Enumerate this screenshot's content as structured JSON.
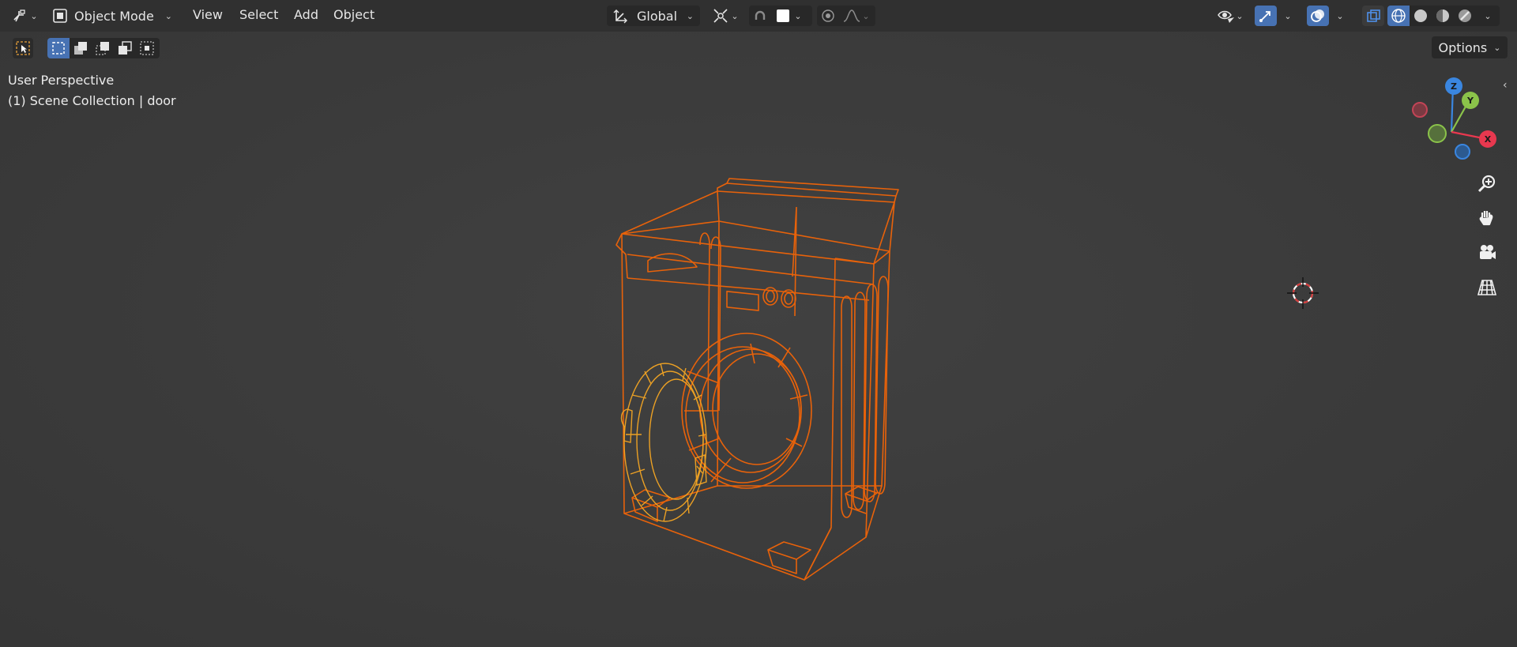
{
  "header": {
    "mode": {
      "label": "Object Mode"
    },
    "menus": [
      "View",
      "Select",
      "Add",
      "Object"
    ],
    "transform_orientation": {
      "label": "Global"
    },
    "options_label": "Options"
  },
  "viewport": {
    "view_name": "User Perspective",
    "collection_info": "(1) Scene Collection | door"
  },
  "gizmo": {
    "z_label": "Z",
    "y_label": "Y",
    "x_label": "X"
  },
  "colors": {
    "header_bg": "#303030",
    "viewport_bg": "#3d3d3d",
    "accent_blue": "#4772b3",
    "selection_orange": "#e8620a",
    "active_orange": "#f5a623",
    "axis_x": "#e8384f",
    "axis_y": "#8bc34a",
    "axis_z": "#3a86e0"
  },
  "icons": [
    "editor-type-icon",
    "object-mode-icon",
    "transform-orientation-icon",
    "pivot-icon",
    "snap-icon",
    "proportional-edit-icon",
    "visibility-icon",
    "gizmo-icon",
    "overlay-icon",
    "xray-icon",
    "wireframe-shading-icon",
    "solid-shading-icon",
    "material-shading-icon",
    "rendered-shading-icon",
    "zoom-icon",
    "pan-hand-icon",
    "camera-icon",
    "grid-icon",
    "3d-cursor-icon"
  ]
}
